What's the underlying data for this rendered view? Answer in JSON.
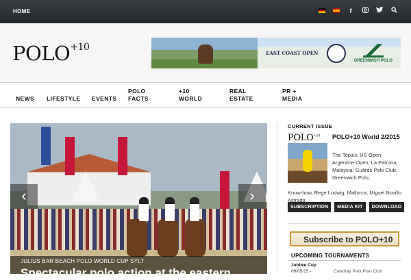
{
  "topbar": {
    "home_label": "HOME",
    "icons": [
      "flag-de",
      "flag-es",
      "facebook-icon",
      "instagram-icon",
      "twitter-icon",
      "search-icon"
    ]
  },
  "header": {
    "logo_text": "POLO",
    "logo_sup": "+10",
    "banner": {
      "east_coast_open": "EAST COAST OPEN",
      "greenwich": "GREENWICH POLO"
    }
  },
  "nav": {
    "items": [
      "NEWS",
      "LIFESTYLE",
      "EVENTS",
      "POLO FACTS",
      "+10 WORLD",
      "REAL ESTATE",
      "PR + MEDIA"
    ]
  },
  "slider": {
    "kicker": "JULIUS BAR BEACH POLO WORLD CUP SYLT",
    "headline": "Spectacular polo action at the eastern",
    "prev_glyph": "‹",
    "next_glyph": "›"
  },
  "sidebar": {
    "current_issue_title": "CURRENT ISSUE",
    "cover_logo": "POLO",
    "cover_logo_sup": "+10",
    "issue_title": "POLO+10 World 2/2015",
    "issue_desc": "The Topics: US Open, Argentine Open, La Patrona, Malaysia, Guards Polo Club, Greenwich Polo,",
    "issue_desc_cont": "Know-how, Rege Ludwig, Mallorca, Miguel Novillo Astrada",
    "buttons": [
      "SUBSCRIPTION",
      "MEDIA KIT",
      "DOWNLOAD"
    ],
    "subscribe_text": "Subscribe to POLO+10",
    "tournaments_title": "UPCOMING TOURNAMENTS",
    "tournaments": [
      {
        "name": "Jubilee Cup",
        "date": "09/05/15 -",
        "venue": "Cowdray Park Polo Club"
      }
    ]
  }
}
